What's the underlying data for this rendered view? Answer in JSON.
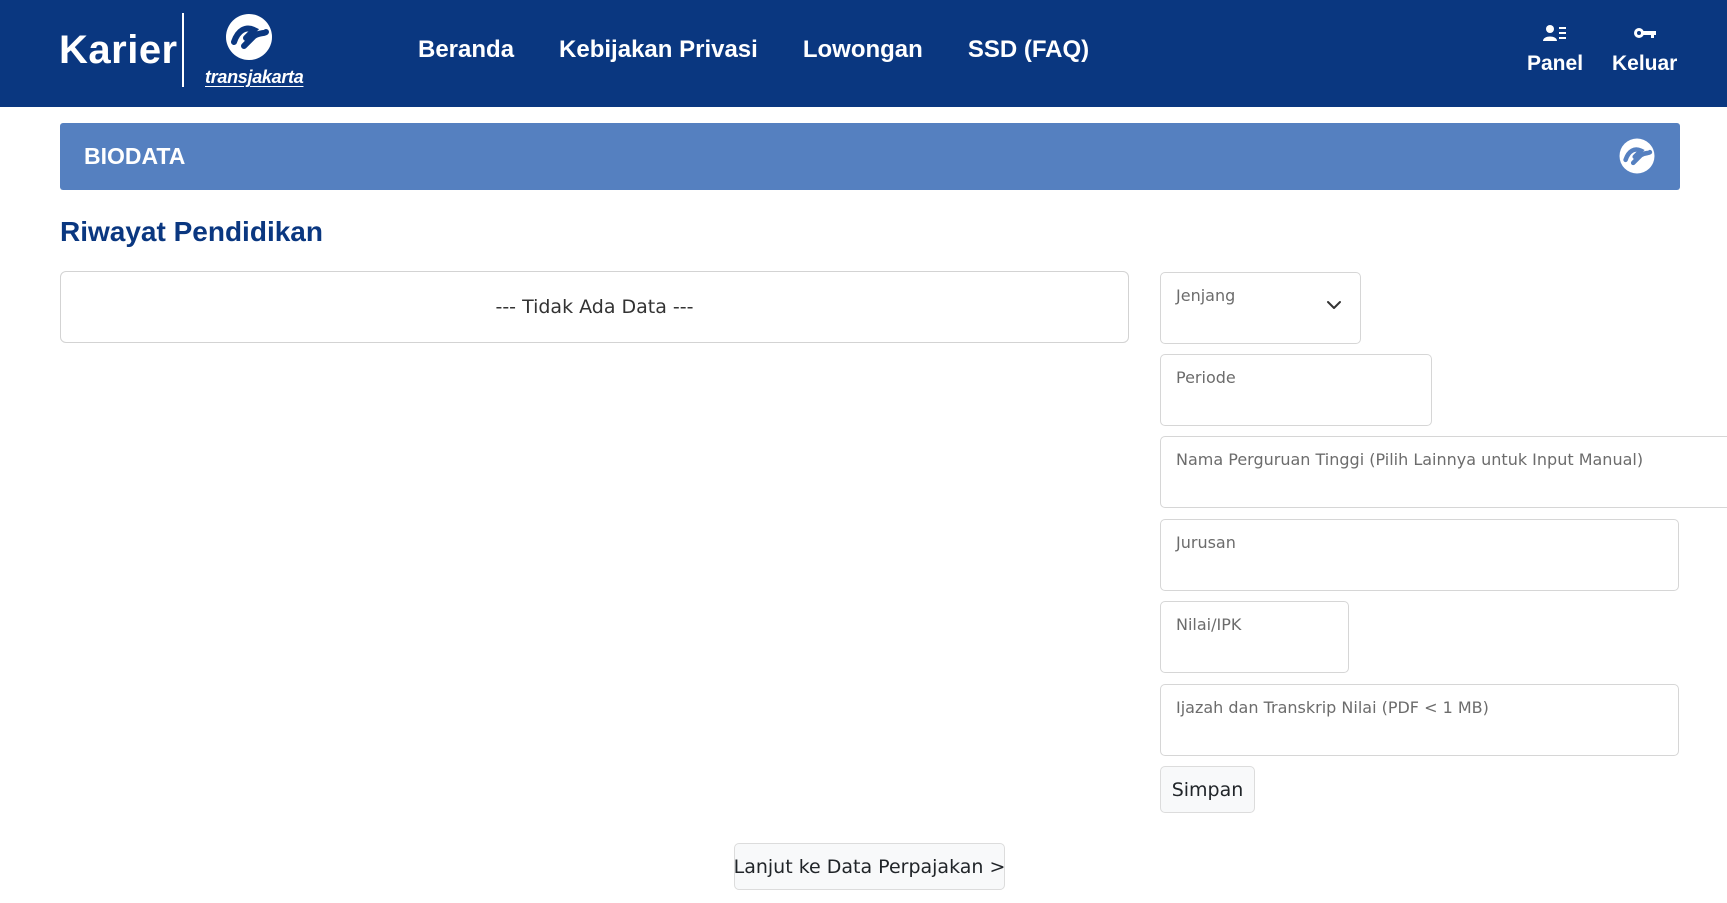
{
  "header": {
    "brand_title": "Karier",
    "logo_text": "transjakarta",
    "nav_links": [
      "Beranda",
      "Kebijakan Privasi",
      "Lowongan",
      "SSD (FAQ)"
    ],
    "actions": {
      "panel": {
        "label": "Panel",
        "icon": "user-list-icon"
      },
      "keluar": {
        "label": "Keluar",
        "icon": "key-icon"
      }
    }
  },
  "biodata": {
    "title": "BIODATA",
    "icon": "transjakarta-logo-icon"
  },
  "section": {
    "title": "Riwayat Pendidikan",
    "empty_message": "--- Tidak Ada Data ---"
  },
  "form": {
    "jenjang": {
      "placeholder": "Jenjang",
      "value": ""
    },
    "periode": {
      "placeholder": "Periode",
      "value": ""
    },
    "nama_perguruan": {
      "placeholder": "Nama Perguruan Tinggi (Pilih Lainnya untuk Input Manual)",
      "value": ""
    },
    "jurusan": {
      "placeholder": "Jurusan",
      "value": ""
    },
    "nilai": {
      "placeholder": "Nilai/IPK",
      "value": ""
    },
    "ijazah": {
      "placeholder": "Ijazah dan Transkrip Nilai (PDF < 1 MB)",
      "value": ""
    },
    "save_label": "Simpan"
  },
  "footer": {
    "next_label": "Lanjut ke Data Perpajakan >"
  },
  "colors": {
    "navbar": "#0a3780",
    "biodata_bar": "#5580c0",
    "section_title": "#0a3780"
  }
}
